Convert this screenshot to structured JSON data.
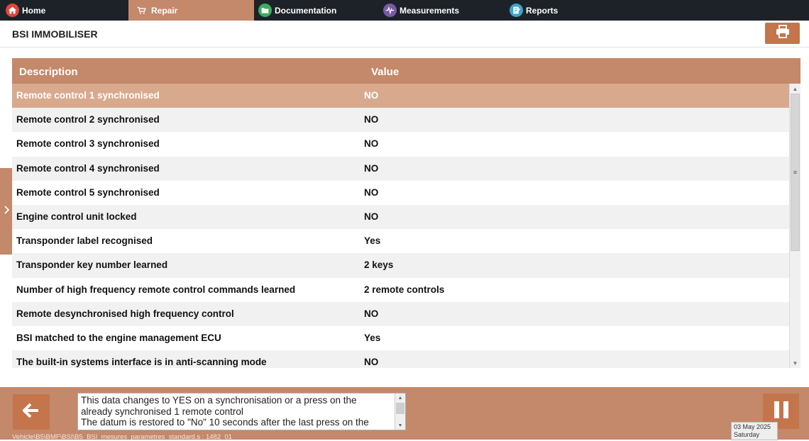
{
  "nav": {
    "tabs": [
      {
        "label": "Home",
        "icon": "home-icon",
        "color": "#e0453a"
      },
      {
        "label": "Repair",
        "icon": "cart-icon",
        "active": true
      },
      {
        "label": "Documentation",
        "icon": "folder-icon",
        "color": "#3cae5a"
      },
      {
        "label": "Measurements",
        "icon": "waveform-icon",
        "color": "#7a5aa6"
      },
      {
        "label": "Reports",
        "icon": "report-icon",
        "color": "#3aa7c8"
      }
    ]
  },
  "header": {
    "title": "BSI IMMOBILISER",
    "print_icon": "printer-icon"
  },
  "table": {
    "columns": {
      "description": "Description",
      "value": "Value"
    },
    "rows": [
      {
        "description": "Remote control 1 synchronised",
        "value": "NO"
      },
      {
        "description": "Remote control 2 synchronised",
        "value": "NO"
      },
      {
        "description": "Remote control 3 synchronised",
        "value": "NO"
      },
      {
        "description": "Remote control 4 synchronised",
        "value": "NO"
      },
      {
        "description": "Remote control 5 synchronised",
        "value": "NO"
      },
      {
        "description": "Engine control unit locked",
        "value": "NO"
      },
      {
        "description": "Transponder label recognised",
        "value": "Yes"
      },
      {
        "description": "Transponder key number learned",
        "value": "2 keys"
      },
      {
        "description": "Number of high frequency remote control commands learned",
        "value": "2 remote controls"
      },
      {
        "description": "Remote desynchronised high frequency control",
        "value": "NO"
      },
      {
        "description": "BSI matched to the engine management ECU",
        "value": "Yes"
      },
      {
        "description": "The built-in systems interface is in anti-scanning mode",
        "value": "NO"
      }
    ],
    "selected_index": 0
  },
  "footer": {
    "help_lines": [
      "This data changes to YES on a synchronisation or a press on the",
      "already synchronised 1 remote control",
      "The datum is restored to \"No\" 10 seconds after the last press on the"
    ],
    "path": "Vehicle\\B5\\BMF\\BSI\\B5_BSI_mesures_parametres_standard.s : 1482_01",
    "date": "03 May 2025",
    "day": "Saturday"
  },
  "colors": {
    "accent": "#c4886a",
    "button": "#c4754c",
    "selected_row": "#d9a98e",
    "nav_bg": "#1d2228"
  }
}
